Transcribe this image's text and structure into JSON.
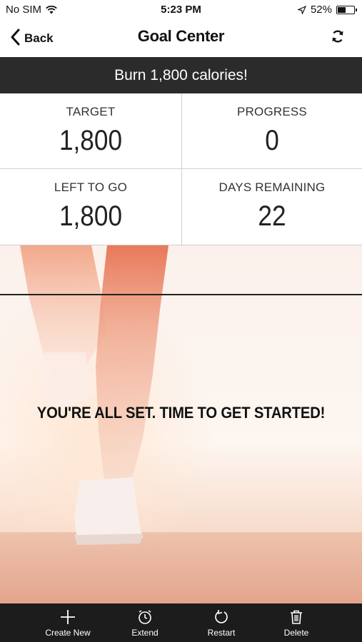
{
  "status_bar": {
    "carrier": "No SIM",
    "time": "5:23 PM",
    "battery": "52%",
    "battery_level": 0.52
  },
  "nav": {
    "back_label": "Back",
    "title": "Goal Center"
  },
  "goal": {
    "banner": "Burn 1,800 calories!"
  },
  "stats": [
    {
      "label": "TARGET",
      "value": "1,800"
    },
    {
      "label": "PROGRESS",
      "value": "0"
    },
    {
      "label": "LEFT TO GO",
      "value": "1,800"
    },
    {
      "label": "DAYS REMAINING",
      "value": "22"
    }
  ],
  "hero": {
    "message": "YOU'RE ALL SET. TIME TO GET STARTED!"
  },
  "tabs": [
    {
      "label": "Create New",
      "icon": "plus-icon"
    },
    {
      "label": "Extend",
      "icon": "stopwatch-icon"
    },
    {
      "label": "Restart",
      "icon": "restart-icon"
    },
    {
      "label": "Delete",
      "icon": "trash-icon"
    }
  ],
  "colors": {
    "banner_bg": "#2b2b2b",
    "tabbar_bg": "#1c1c1c"
  }
}
